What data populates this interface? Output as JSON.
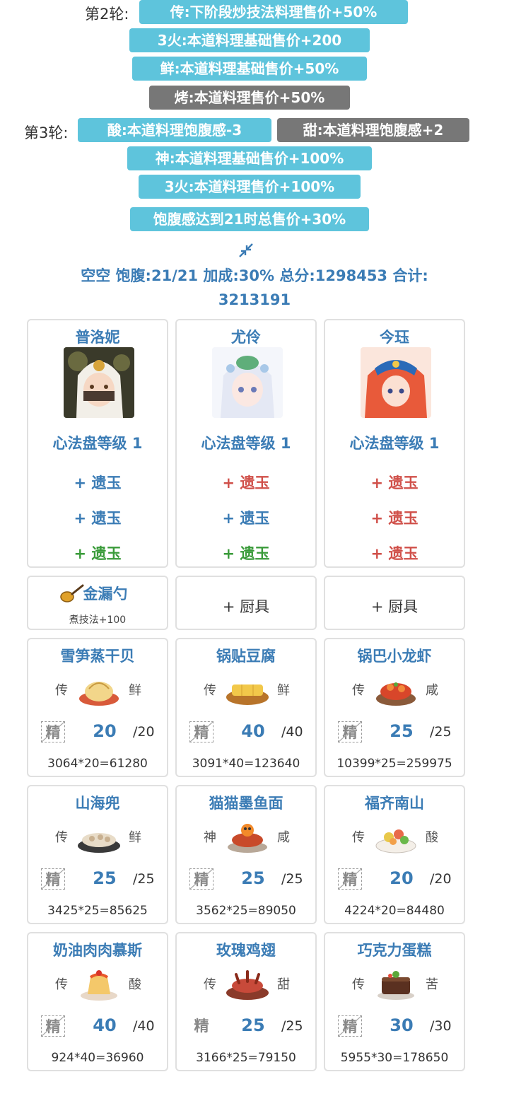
{
  "rules": {
    "round2_label": "第2轮:",
    "round2": [
      "传:下阶段炒技法料理售价+50%",
      "3火:本道料理基础售价+200",
      "鲜:本道料理基础售价+50%",
      "烤:本道料理售价+50%"
    ],
    "round3_label": "第3轮:",
    "round3": [
      "酸:本道料理饱腹感-3",
      "甜:本道料理饱腹感+2",
      "神:本道料理基础售价+100%",
      "3火:本道料理售价+100%",
      "饱腹感达到21时总售价+30%"
    ]
  },
  "summary": {
    "line1": "空空 饱腹:21/21 加成:30% 总分:1298453 合计:",
    "line2": "3213191"
  },
  "chefs": [
    {
      "name": "普洛妮",
      "level": "心法盘等级 1",
      "jades": [
        "+ 遗玉",
        "+ 遗玉",
        "+ 遗玉"
      ],
      "jade_colors": [
        "#3b7cb5",
        "#3b7cb5",
        "#3a9b3a"
      ]
    },
    {
      "name": "尤伶",
      "level": "心法盘等级 1",
      "jades": [
        "+ 遗玉",
        "+ 遗玉",
        "+ 遗玉"
      ],
      "jade_colors": [
        "#d0504a",
        "#3b7cb5",
        "#3a9b3a"
      ]
    },
    {
      "name": "今珏",
      "level": "心法盘等级 1",
      "jades": [
        "+ 遗玉",
        "+ 遗玉",
        "+ 遗玉"
      ],
      "jade_colors": [
        "#d0504a",
        "#d0504a",
        "#d0504a"
      ]
    }
  ],
  "equipment": [
    {
      "name": "金漏勺",
      "desc": "煮技法+100",
      "icon": "golden-ladle-icon"
    },
    {
      "label": "+ 厨具"
    },
    {
      "label": "+ 厨具"
    }
  ],
  "dishes": [
    {
      "name": "雪笋蒸干贝",
      "rank": "传",
      "flavor": "鲜",
      "refine": "精",
      "qty": "20",
      "max": "/20",
      "calc": "3064*20=61280"
    },
    {
      "name": "锅贴豆腐",
      "rank": "传",
      "flavor": "鲜",
      "refine": "精",
      "qty": "40",
      "max": "/40",
      "calc": "3091*40=123640"
    },
    {
      "name": "锅巴小龙虾",
      "rank": "传",
      "flavor": "咸",
      "refine": "精",
      "qty": "25",
      "max": "/25",
      "calc": "10399*25=259975"
    },
    {
      "name": "山海兜",
      "rank": "传",
      "flavor": "鲜",
      "refine": "精",
      "qty": "25",
      "max": "/25",
      "calc": "3425*25=85625"
    },
    {
      "name": "猫猫墨鱼面",
      "rank": "神",
      "flavor": "咸",
      "refine": "精",
      "qty": "25",
      "max": "/25",
      "calc": "3562*25=89050"
    },
    {
      "name": "福齐南山",
      "rank": "传",
      "flavor": "酸",
      "refine": "精",
      "qty": "20",
      "max": "/20",
      "calc": "4224*20=84480"
    },
    {
      "name": "奶油肉肉慕斯",
      "rank": "传",
      "flavor": "酸",
      "refine": "精",
      "qty": "40",
      "max": "/40",
      "calc": "924*40=36960"
    },
    {
      "name": "玫瑰鸡翅",
      "rank": "传",
      "flavor": "甜",
      "refine": "精",
      "qty": "25",
      "max": "/25",
      "calc": "3166*25=79150"
    },
    {
      "name": "巧克力蛋糕",
      "rank": "传",
      "flavor": "苦",
      "refine": "精",
      "qty": "30",
      "max": "/30",
      "calc": "5955*30=178650"
    }
  ]
}
